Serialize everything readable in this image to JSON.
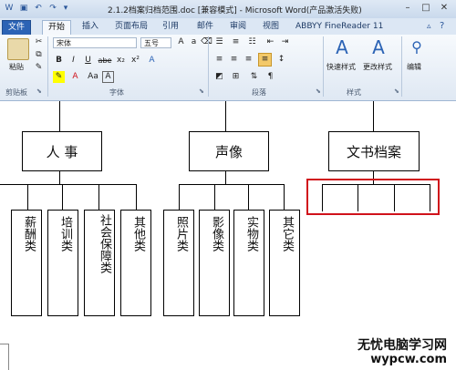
{
  "window": {
    "title": "2.1.2档案归档范围.doc [兼容模式] - Microsoft Word(产品激活失败)",
    "controls": [
      "–",
      "□",
      "✕"
    ]
  },
  "tabs": [
    {
      "label": "文件"
    },
    {
      "label": "开始"
    },
    {
      "label": "插入"
    },
    {
      "label": "页面布局"
    },
    {
      "label": "引用"
    },
    {
      "label": "邮件"
    },
    {
      "label": "审阅"
    },
    {
      "label": "视图"
    },
    {
      "label": "ABBYY FineReader 11"
    }
  ],
  "ribbon": {
    "clipboard": {
      "paste_label": "粘贴",
      "group_label": "剪贴板"
    },
    "font": {
      "font_name": "宋体",
      "font_size": "五号",
      "group_label": "字体",
      "buttons": [
        "B",
        "I",
        "U",
        "abe",
        "x₂",
        "x²",
        "A",
        "Aa",
        "A"
      ]
    },
    "paragraph": {
      "group_label": "段落"
    },
    "styles": {
      "quick_styles": "快速样式",
      "change_styles": "更改样式",
      "group_label": "样式"
    },
    "editing": {
      "label": "编辑"
    }
  },
  "document": {
    "top_boxes": [
      "人  事",
      "声像",
      "文书档案"
    ],
    "sub_boxes_left": [
      "薪酬类",
      "培训类",
      "社会保障类",
      "其他类"
    ],
    "sub_boxes_mid": [
      "照片类",
      "影像类",
      "实物类",
      "其它类"
    ]
  },
  "watermark": {
    "line1": "无忧电脑学习网",
    "line2": "wypcw.com"
  },
  "colors": {
    "accent": "#2b63b5",
    "highlight": "#d0121b"
  }
}
